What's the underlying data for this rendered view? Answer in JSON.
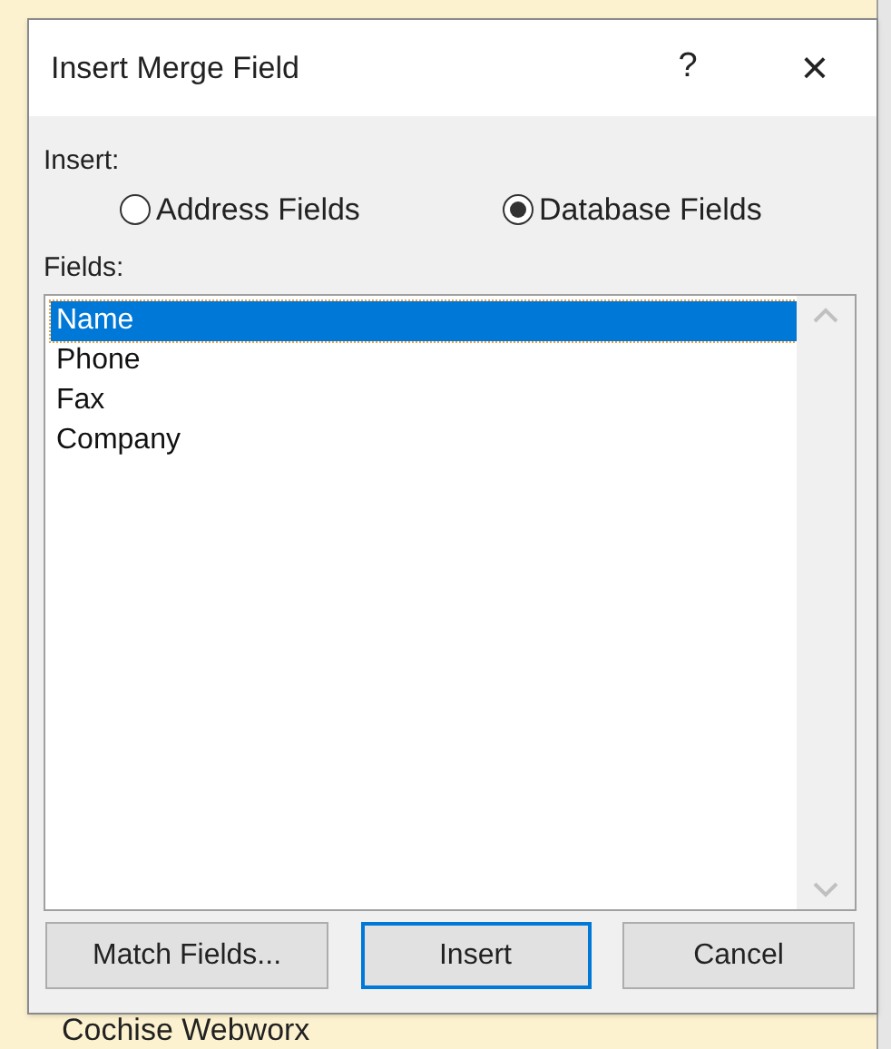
{
  "window": {
    "title": "Insert Merge Field",
    "help": "?",
    "close": "×"
  },
  "insert": {
    "label": "Insert:",
    "options": [
      {
        "label": "Address Fields",
        "selected": false
      },
      {
        "label": "Database Fields",
        "selected": true
      }
    ]
  },
  "fields": {
    "label": "Fields:",
    "items": [
      {
        "label": "Name",
        "selected": true
      },
      {
        "label": "Phone",
        "selected": false
      },
      {
        "label": "Fax",
        "selected": false
      },
      {
        "label": "Company",
        "selected": false
      }
    ]
  },
  "buttons": [
    {
      "label": "Match Fields...",
      "default": false
    },
    {
      "label": "Insert",
      "default": true
    },
    {
      "label": "Cancel",
      "default": false
    }
  ],
  "background_text": "Cochise Webworx"
}
